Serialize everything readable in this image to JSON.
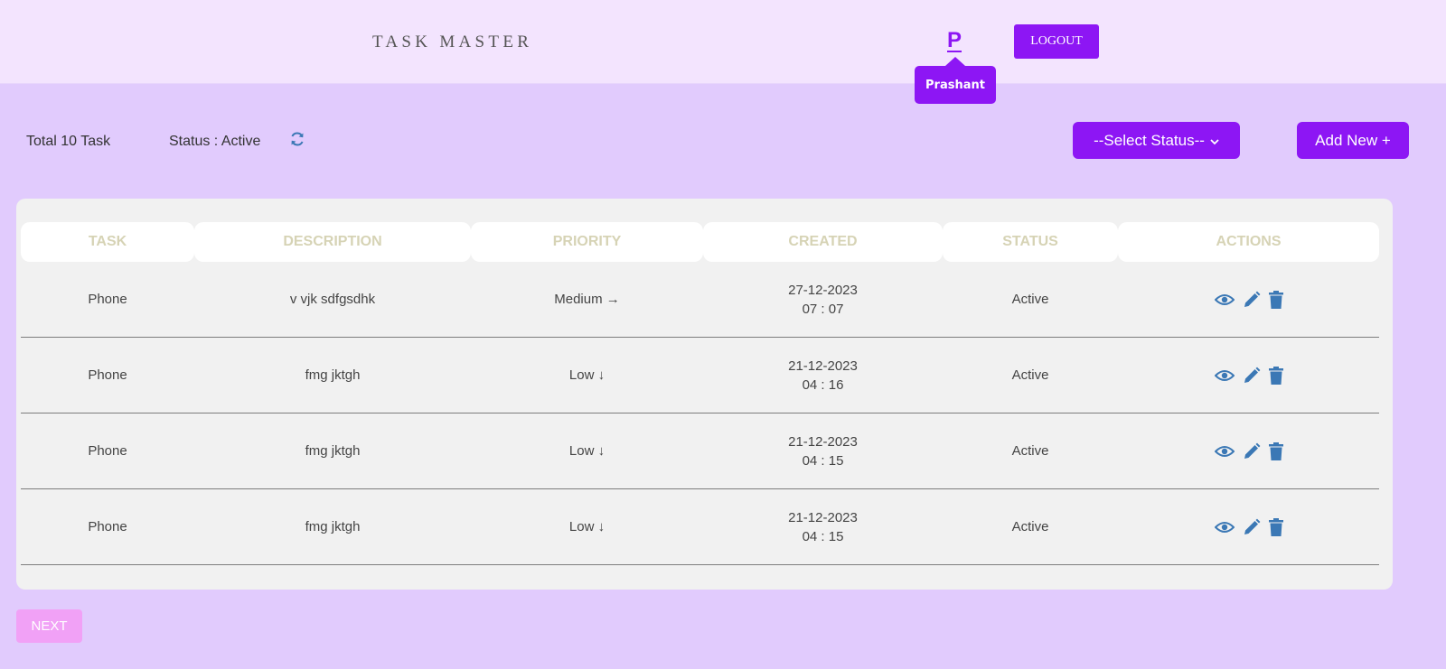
{
  "header": {
    "brand": "TASK MASTER",
    "user_initial": "P",
    "user_tooltip": "Prashant",
    "logout_label": "LOGOUT"
  },
  "toolbar": {
    "total_label": "Total 10 Task",
    "status_label": "Status : Active",
    "select_status_label": "--Select Status--",
    "add_new_label": "Add New +"
  },
  "table": {
    "columns": [
      "TASK",
      "DESCRIPTION",
      "PRIORITY",
      "CREATED",
      "STATUS",
      "ACTIONS"
    ],
    "rows": [
      {
        "task": "Phone",
        "description": "v vjk sdfgsdhk",
        "priority": "Medium →",
        "created_date": "27-12-2023",
        "created_time": "07 : 07",
        "status": "Active"
      },
      {
        "task": "Phone",
        "description": "fmg jktgh",
        "priority": "Low ↓",
        "created_date": "21-12-2023",
        "created_time": "04 : 16",
        "status": "Active"
      },
      {
        "task": "Phone",
        "description": "fmg jktgh",
        "priority": "Low ↓",
        "created_date": "21-12-2023",
        "created_time": "04 : 15",
        "status": "Active"
      },
      {
        "task": "Phone",
        "description": "fmg jktgh",
        "priority": "Low ↓",
        "created_date": "21-12-2023",
        "created_time": "04 : 15",
        "status": "Active"
      }
    ],
    "action_icons": [
      "eye-icon",
      "pencil-icon",
      "trash-icon"
    ]
  },
  "pagination": {
    "next_label": "NEXT"
  },
  "colors": {
    "accent": "#8d16f4",
    "page_bg": "#e1cbfd",
    "header_bg": "#f3e4fe",
    "icon_blue": "#3b78b5",
    "header_text": "#d6d3b5",
    "next_button": "#f1a1f6"
  }
}
